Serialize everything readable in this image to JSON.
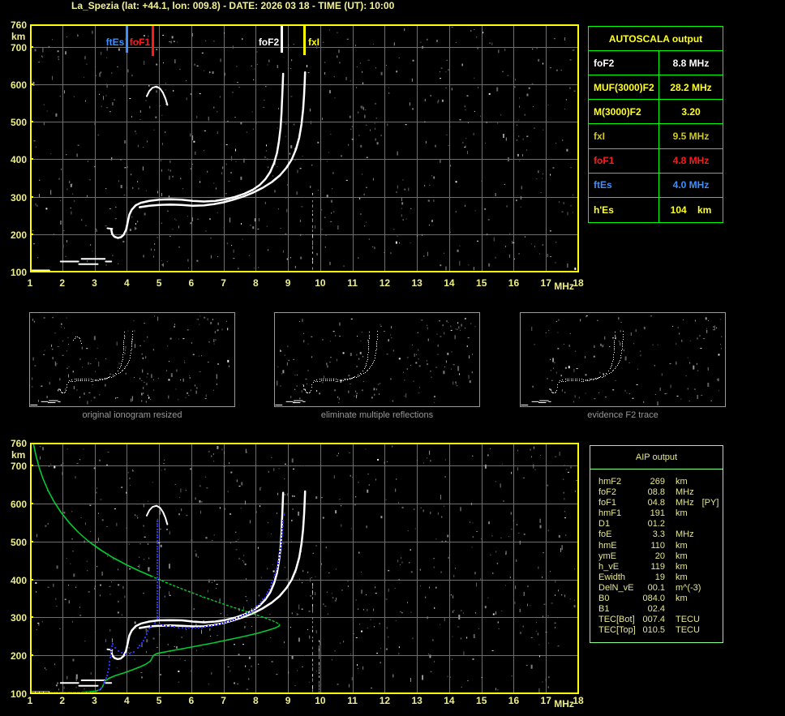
{
  "title": "La_Spezia (lat: +44.1, lon: 009.8) - DATE: 2026 03 18 - TIME (UT): 10:00",
  "autoscala_table": {
    "header": "AUTOSCALA output",
    "rows": [
      {
        "label": "foF2",
        "value": "8.8 MHz",
        "color": "#ffffff"
      },
      {
        "label": "MUF(3000)F2",
        "value": "28.2 MHz",
        "color": "#ffff22"
      },
      {
        "label": "M(3000)F2",
        "value": "3.20",
        "color": "#ffff22"
      },
      {
        "label": "fxI",
        "value": "9.5 MHz",
        "color": "#cfc920"
      },
      {
        "label": "foF1",
        "value": "4.8 MHz",
        "color": "#ff1a1a"
      },
      {
        "label": "ftEs",
        "value": "4.0 MHz",
        "color": "#3d8fff"
      },
      {
        "label": "h'Es",
        "value": "104    km",
        "color": "#ffff22"
      }
    ]
  },
  "aip_table": {
    "header": "AIP output",
    "rows": [
      {
        "label": "hmF2",
        "value": "269",
        "unit": "km",
        "extra": ""
      },
      {
        "label": "foF2",
        "value": "08.8",
        "unit": "MHz",
        "extra": ""
      },
      {
        "label": "foF1",
        "value": "04.8",
        "unit": "MHz",
        "extra": "[PY]"
      },
      {
        "label": "hmF1",
        "value": "191",
        "unit": "km",
        "extra": ""
      },
      {
        "label": "D1",
        "value": "01.2",
        "unit": "",
        "extra": ""
      },
      {
        "label": "foE",
        "value": "3.3",
        "unit": "MHz",
        "extra": ""
      },
      {
        "label": "hmE",
        "value": "110",
        "unit": "km",
        "extra": ""
      },
      {
        "label": "ymE",
        "value": "20",
        "unit": "km",
        "extra": ""
      },
      {
        "label": "h_vE",
        "value": "119",
        "unit": "km",
        "extra": ""
      },
      {
        "label": "Ewidth",
        "value": "19",
        "unit": "km",
        "extra": ""
      },
      {
        "label": "DelN_vE",
        "value": "00.1",
        "unit": "m^(-3)",
        "extra": ""
      },
      {
        "label": "B0",
        "value": "084.0",
        "unit": "km",
        "extra": ""
      },
      {
        "label": "B1",
        "value": "02.4",
        "unit": "",
        "extra": ""
      },
      {
        "label": "TEC[Bot]",
        "value": "007.4",
        "unit": "TECU",
        "extra": ""
      },
      {
        "label": "TEC[Top]",
        "value": "010.5",
        "unit": "TECU",
        "extra": ""
      }
    ]
  },
  "thumbnails": [
    {
      "caption": "original ionogram resized"
    },
    {
      "caption": "eliminate multiple reflections"
    },
    {
      "caption": "evidence F2 trace"
    }
  ],
  "axes": {
    "x_ticks": [
      "1",
      "2",
      "3",
      "4",
      "5",
      "6",
      "7",
      "8",
      "9",
      "10",
      "11",
      "12",
      "13",
      "14",
      "15",
      "16",
      "17",
      "18"
    ],
    "x_unit": "MHz",
    "y_ticks": [
      "760",
      "700",
      "600",
      "500",
      "400",
      "300",
      "200",
      "100"
    ],
    "y_tick_values": [
      760,
      700,
      600,
      500,
      400,
      300,
      200,
      100
    ],
    "y_unit": "km"
  },
  "markers": [
    {
      "label": "ftEs",
      "freq": 4.0,
      "color": "#3d8fff",
      "side": "left",
      "len": 33
    },
    {
      "label": "foF1",
      "freq": 4.8,
      "color": "#ff1a1a",
      "side": "left",
      "len": 37
    },
    {
      "label": "foF2",
      "freq": 8.8,
      "color": "#ffffff",
      "side": "left",
      "len": 33
    },
    {
      "label": "fxI",
      "freq": 9.5,
      "color": "#ffff00",
      "side": "right",
      "len": 36
    }
  ],
  "chart_data": [
    {
      "id": "ionogram",
      "type": "scatter",
      "title": "autoscaled ionogram",
      "xlabel": "MHz",
      "ylabel": "km",
      "xlim": [
        1,
        18
      ],
      "ylim": [
        100,
        760
      ],
      "grid": true,
      "scaled_values": {
        "foF2_MHz": 8.8,
        "MUF3000F2_MHz": 28.2,
        "M3000F2": 3.2,
        "fxI_MHz": 9.5,
        "foF1_MHz": 4.8,
        "ftEs_MHz": 4.0,
        "hEs_km": 104
      },
      "series": [
        {
          "name": "F-trace-ordinary",
          "color": "#ffffff",
          "style": "solid",
          "points": [
            [
              3.52,
              212
            ],
            [
              3.55,
              200
            ],
            [
              3.62,
              193
            ],
            [
              3.72,
              190
            ],
            [
              3.82,
              192
            ],
            [
              3.9,
              198
            ],
            [
              3.98,
              212
            ],
            [
              4.03,
              232
            ],
            [
              4.08,
              252
            ],
            [
              4.16,
              266
            ],
            [
              4.28,
              277
            ],
            [
              4.45,
              284
            ],
            [
              4.7,
              289
            ],
            [
              5.0,
              292
            ],
            [
              5.35,
              293
            ],
            [
              5.7,
              292
            ],
            [
              6.05,
              289
            ],
            [
              6.4,
              287
            ],
            [
              6.75,
              289
            ],
            [
              7.05,
              293
            ],
            [
              7.35,
              299
            ],
            [
              7.65,
              308
            ],
            [
              7.9,
              318
            ],
            [
              8.12,
              331
            ],
            [
              8.3,
              347
            ],
            [
              8.45,
              366
            ],
            [
              8.57,
              390
            ],
            [
              8.66,
              417
            ],
            [
              8.72,
              448
            ],
            [
              8.77,
              484
            ],
            [
              8.8,
              524
            ],
            [
              8.82,
              565
            ],
            [
              8.84,
              605
            ],
            [
              8.85,
              628
            ]
          ]
        },
        {
          "name": "F-trace-extraordinary",
          "color": "#ffffff",
          "style": "solid",
          "points": [
            [
              4.4,
              272
            ],
            [
              4.7,
              276
            ],
            [
              5.0,
              278
            ],
            [
              5.35,
              279
            ],
            [
              5.7,
              278
            ],
            [
              6.05,
              276
            ],
            [
              6.4,
              277
            ],
            [
              6.7,
              280
            ],
            [
              7.0,
              285
            ],
            [
              7.3,
              292
            ],
            [
              7.6,
              300
            ],
            [
              7.9,
              310
            ],
            [
              8.2,
              323
            ],
            [
              8.5,
              339
            ],
            [
              8.75,
              357
            ],
            [
              8.95,
              377
            ],
            [
              9.12,
              400
            ],
            [
              9.25,
              427
            ],
            [
              9.35,
              458
            ],
            [
              9.42,
              494
            ],
            [
              9.47,
              533
            ],
            [
              9.5,
              572
            ],
            [
              9.52,
              608
            ],
            [
              9.53,
              632
            ]
          ]
        },
        {
          "name": "multiple-reflection-echo",
          "color": "#ffffff",
          "style": "solid",
          "points": [
            [
              4.62,
              568
            ],
            [
              4.7,
              582
            ],
            [
              4.8,
              591
            ],
            [
              4.92,
              594
            ],
            [
              5.03,
              589
            ],
            [
              5.12,
              578
            ],
            [
              5.2,
              562
            ],
            [
              5.26,
              545
            ]
          ]
        },
        {
          "name": "E-region-segments",
          "color": "#ffffff",
          "style": "segments",
          "segments": [
            [
              [
                1.05,
                103
              ],
              [
                1.6,
                103
              ]
            ],
            [
              [
                1.95,
                127
              ],
              [
                2.5,
                127
              ]
            ],
            [
              [
                2.52,
                120
              ],
              [
                3.1,
                120
              ]
            ],
            [
              [
                2.6,
                134
              ],
              [
                3.32,
                134
              ]
            ],
            [
              [
                3.35,
                127
              ],
              [
                3.52,
                127
              ]
            ],
            [
              [
                3.4,
                216
              ],
              [
                3.55,
                214
              ]
            ]
          ]
        }
      ]
    },
    {
      "id": "aip-profile",
      "type": "line",
      "title": "AIP electron density profile and restored trace (plus ionogram background)",
      "xlabel": "MHz",
      "ylabel": "km",
      "xlim": [
        1,
        18
      ],
      "ylim": [
        100,
        760
      ],
      "grid": true,
      "background_series": "same white ionogram traces as chart_data[0]",
      "series": [
        {
          "name": "profile-topside",
          "color": "#00cc33",
          "style": "solid",
          "points": [
            [
              1.1,
              760
            ],
            [
              1.18,
              728
            ],
            [
              1.28,
              696
            ],
            [
              1.4,
              666
            ],
            [
              1.55,
              636
            ],
            [
              1.73,
              607
            ],
            [
              1.95,
              578
            ],
            [
              2.2,
              551
            ],
            [
              2.5,
              524
            ],
            [
              2.82,
              500
            ],
            [
              3.2,
              477
            ],
            [
              3.6,
              456
            ],
            [
              4.0,
              438
            ],
            [
              4.4,
              422
            ],
            [
              4.75,
              409
            ]
          ]
        },
        {
          "name": "profile-topside-extrapolated",
          "color": "#00cc33",
          "style": "dotted",
          "points": [
            [
              4.75,
              409
            ],
            [
              5.1,
              396
            ],
            [
              5.5,
              382
            ],
            [
              5.9,
              369
            ],
            [
              6.3,
              356
            ],
            [
              6.7,
              344
            ],
            [
              7.1,
              332
            ],
            [
              7.5,
              321
            ],
            [
              7.9,
              310
            ],
            [
              8.25,
              300
            ],
            [
              8.5,
              292
            ],
            [
              8.65,
              286
            ],
            [
              8.74,
              281
            ]
          ]
        },
        {
          "name": "profile-bottomside",
          "color": "#00cc33",
          "style": "solid",
          "points": [
            [
              8.74,
              281
            ],
            [
              8.72,
              277
            ],
            [
              8.6,
              272
            ],
            [
              8.38,
              266
            ],
            [
              8.05,
              258
            ],
            [
              7.65,
              250
            ],
            [
              7.2,
              242
            ],
            [
              6.7,
              233
            ],
            [
              6.2,
              225
            ],
            [
              5.7,
              217
            ],
            [
              5.25,
              210
            ],
            [
              4.95,
              205
            ],
            [
              4.85,
              201
            ],
            [
              4.8,
              196
            ],
            [
              4.77,
              190
            ],
            [
              4.72,
              184
            ],
            [
              4.6,
              177
            ],
            [
              4.42,
              170
            ],
            [
              4.18,
              162
            ],
            [
              3.92,
              154
            ],
            [
              3.66,
              147
            ],
            [
              3.46,
              140
            ],
            [
              3.35,
              134
            ],
            [
              3.3,
              128
            ],
            [
              3.27,
              122
            ],
            [
              3.24,
              116
            ],
            [
              3.18,
              110
            ],
            [
              3.05,
              106
            ],
            [
              2.85,
              104
            ],
            [
              2.62,
              103
            ]
          ]
        },
        {
          "name": "restored-E-trace",
          "color": "#2a2aff",
          "style": "dots",
          "points": [
            [
              1.05,
              104
            ],
            [
              3.0,
              104
            ]
          ]
        },
        {
          "name": "restored-F-trace",
          "color": "#2a2aff",
          "style": "dots",
          "points": [
            [
              3.02,
              105
            ],
            [
              3.12,
              110
            ],
            [
              3.2,
              118
            ],
            [
              3.27,
              128
            ],
            [
              3.33,
              142
            ],
            [
              3.38,
              158
            ],
            [
              3.43,
              176
            ],
            [
              3.47,
              196
            ],
            [
              3.5,
              218
            ],
            [
              3.55,
              232
            ],
            [
              3.62,
              222
            ],
            [
              3.72,
              213
            ],
            [
              3.82,
              208
            ],
            [
              3.95,
              205
            ],
            [
              4.08,
              207
            ],
            [
              4.2,
              212
            ],
            [
              4.32,
              221
            ],
            [
              4.44,
              234
            ],
            [
              4.54,
              250
            ],
            [
              4.63,
              266
            ],
            [
              4.72,
              279
            ],
            [
              4.85,
              287
            ],
            [
              5.0,
              284
            ],
            [
              5.2,
              280
            ],
            [
              5.45,
              277
            ],
            [
              5.7,
              275
            ],
            [
              6.0,
              274
            ],
            [
              6.3,
              276
            ],
            [
              6.6,
              280
            ],
            [
              6.9,
              285
            ],
            [
              7.15,
              292
            ],
            [
              7.4,
              300
            ],
            [
              7.65,
              310
            ],
            [
              7.88,
              322
            ],
            [
              8.08,
              337
            ],
            [
              8.26,
              355
            ],
            [
              8.4,
              376
            ],
            [
              8.52,
              400
            ],
            [
              8.62,
              428
            ],
            [
              8.7,
              458
            ],
            [
              8.76,
              492
            ],
            [
              8.8,
              527
            ],
            [
              8.83,
              558
            ],
            [
              8.85,
              572
            ]
          ]
        },
        {
          "name": "F1-cusp-spike",
          "color": "#2a2aff",
          "style": "dots",
          "points": [
            [
              4.92,
              298
            ],
            [
              4.92,
              556
            ]
          ]
        }
      ]
    }
  ]
}
